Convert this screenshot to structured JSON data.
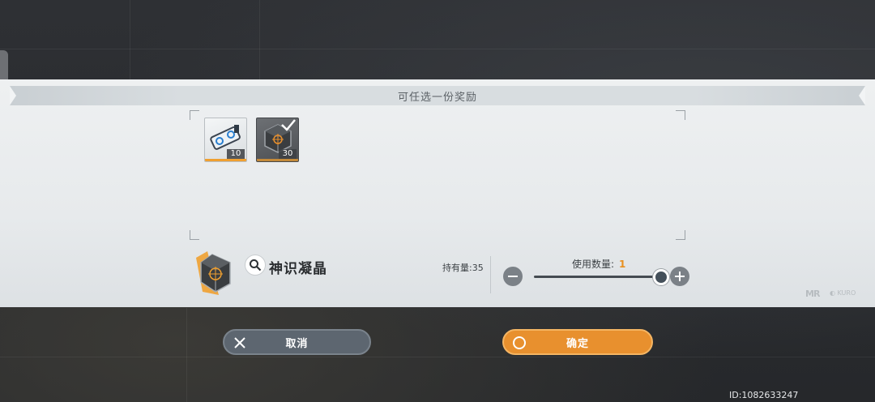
{
  "panel": {
    "title": "可任选一份奖励"
  },
  "rewards": [
    {
      "count": "10",
      "selected": false,
      "icon": "data-chip-icon"
    },
    {
      "count": "30",
      "selected": true,
      "icon": "crystal-cube-icon"
    }
  ],
  "item": {
    "name": "神识凝晶",
    "hold_label": "持有量:",
    "hold_value": "35"
  },
  "quantity": {
    "label": "使用数量:",
    "value": "1",
    "slider_fraction": 1.0
  },
  "buttons": {
    "cancel": "取消",
    "confirm": "确定"
  },
  "footer": {
    "id_text": "ID:1082633247"
  },
  "colors": {
    "accent": "#e8902e",
    "cancel": "#5d6670"
  }
}
